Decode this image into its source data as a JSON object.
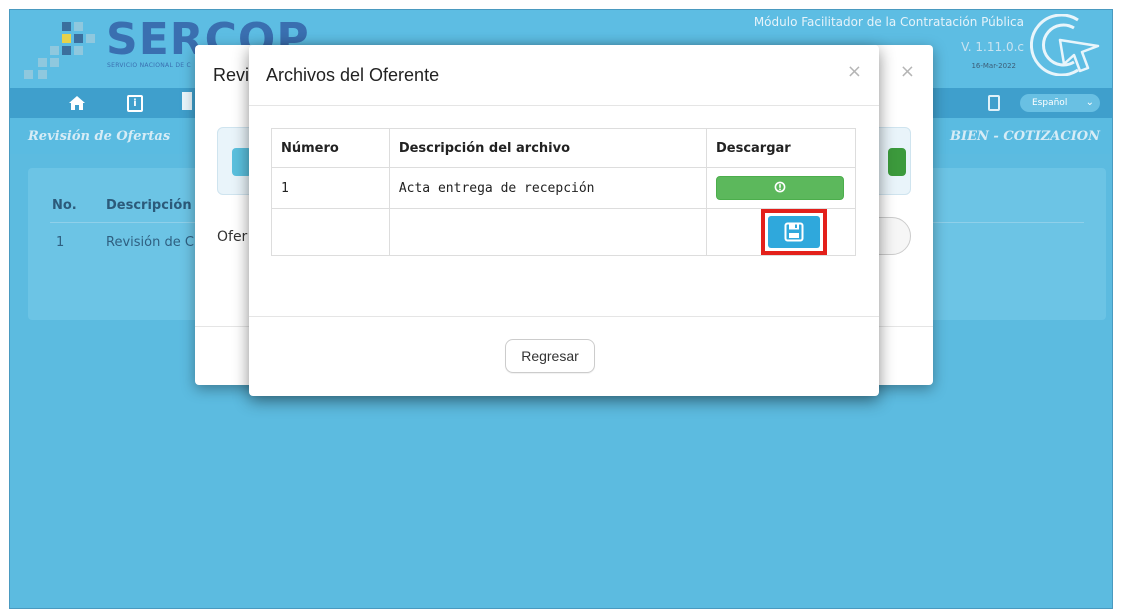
{
  "app": {
    "logo_text": "SERCOP",
    "logo_subtitle": "SERVICIO NACIONAL DE C",
    "module_title": "Módulo Facilitador de la Contratación Pública",
    "version": "V. 1.11.0.c",
    "date": "16-Mar-2022",
    "language": "Español",
    "breadcrumb": "Revisión de Ofertas",
    "breadcrumb_right": "BIEN - COTIZACION",
    "bg_table": {
      "headers": [
        "No.",
        "Descripción"
      ],
      "row": [
        "1",
        "Revisión de C"
      ]
    }
  },
  "modal_back": {
    "title": "Revi",
    "oferente_label": "Ofer"
  },
  "modal_front": {
    "title": "Archivos del Oferente",
    "close_symbol": "×",
    "table": {
      "headers": [
        "Número",
        "Descripción del archivo",
        "Descargar"
      ],
      "rows": [
        {
          "numero": "1",
          "descripcion": "Acta entrega de recepción"
        },
        {
          "numero": "",
          "descripcion": ""
        }
      ]
    },
    "back_button": "Regresar"
  },
  "colors": {
    "background": "#5cbbe0",
    "download_button": "#5cb85c",
    "save_button": "#2fa8dc",
    "highlight": "#e3201b"
  },
  "icons": [
    "home-icon",
    "info-icon",
    "document-icon",
    "download-icon",
    "save-icon",
    "close-icon",
    "chevron-down-icon",
    "cursor-logo-icon"
  ]
}
